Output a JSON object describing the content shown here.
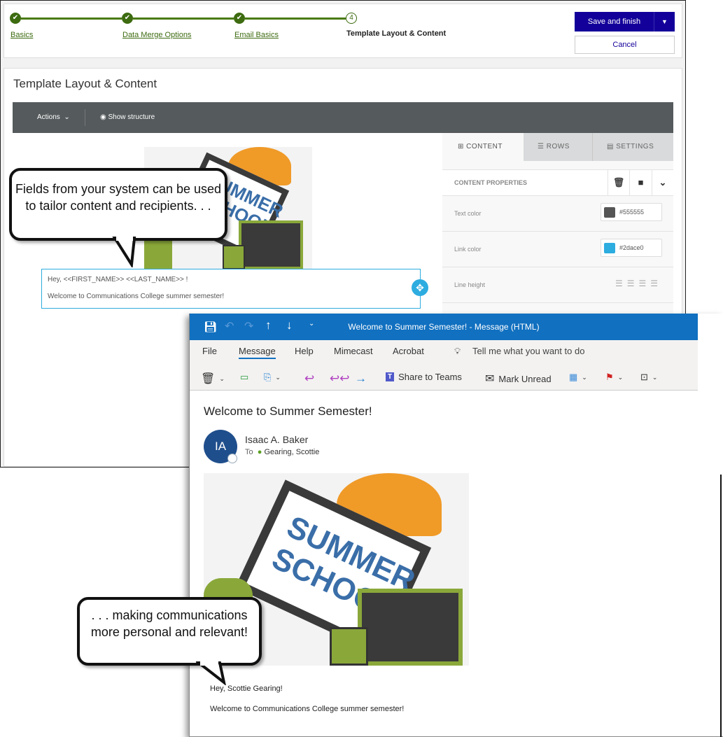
{
  "wizard": {
    "steps": [
      {
        "label": "Basics",
        "status": "complete"
      },
      {
        "label": "Data Merge Options",
        "status": "complete"
      },
      {
        "label": "Email Basics",
        "status": "complete"
      },
      {
        "number": "4",
        "label": "Template Layout & Content",
        "status": "current"
      }
    ],
    "save_label": "Save and finish",
    "cancel_label": "Cancel",
    "accent_color": "#13009a",
    "step_color": "#3d6b10"
  },
  "editor": {
    "title": "Template Layout & Content",
    "toolbar": {
      "actions_label": "Actions",
      "show_structure_label": "Show structure"
    },
    "tabs": [
      {
        "label": "CONTENT",
        "icon": "grid-icon"
      },
      {
        "label": "ROWS",
        "icon": "rows-icon"
      },
      {
        "label": "SETTINGS",
        "icon": "settings-icon"
      }
    ],
    "content_properties_label": "CONTENT PROPERTIES",
    "properties": [
      {
        "label": "Text color",
        "value": "#555555"
      },
      {
        "label": "Link color",
        "value": "#2dace0"
      },
      {
        "label": "Line height"
      }
    ],
    "body_line1": "Hey, <<FIRST_NAME>>  <<LAST_NAME>> !",
    "body_line2": "Welcome to Communications College summer semester!"
  },
  "callouts": {
    "top": "Fields from your system can be used to tailor content and recipients. . .",
    "bottom": ". . . making communications more personal and relevant!"
  },
  "outlook": {
    "window_title": "Welcome to Summer Semester! - Message (HTML)",
    "menu": [
      "File",
      "Message",
      "Help",
      "Mimecast",
      "Acrobat"
    ],
    "active_menu": "Message",
    "tell_me": "Tell me what you want to do",
    "share_teams": "Share to Teams",
    "mark_unread": "Mark Unread",
    "subject": "Welcome to Summer Semester!",
    "sender": "Isaac A. Baker",
    "initials": "IA",
    "to_label": "To",
    "recipient": "Gearing, Scottie",
    "body_line1": "Hey, Scottie Gearing!",
    "body_line2": "Welcome to Communications College summer semester!",
    "title_bar_color": "#1170c0"
  },
  "image_text": "SUMMER SCHOOL"
}
